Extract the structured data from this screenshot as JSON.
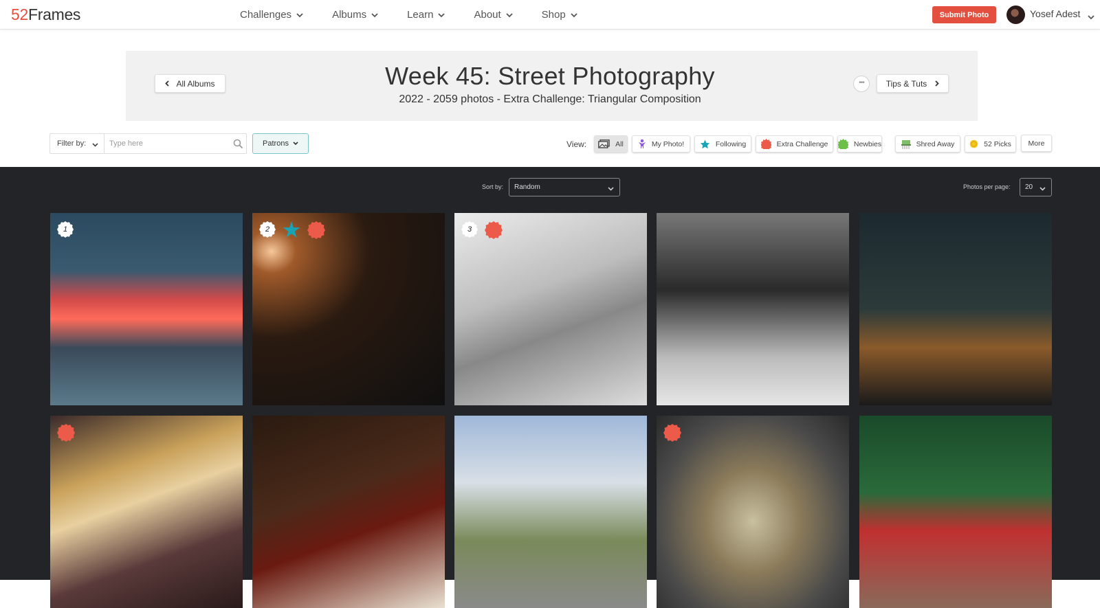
{
  "nav": {
    "logo_num": "52",
    "logo_text": "Frames",
    "menu": [
      {
        "label": "Challenges"
      },
      {
        "label": "Albums"
      },
      {
        "label": "Learn"
      },
      {
        "label": "About"
      },
      {
        "label": "Shop"
      }
    ],
    "submit_label": "Submit Photo",
    "username": "Yosef Adest"
  },
  "header": {
    "all_albums_label": "All Albums",
    "title": "Week 45: Street Photography",
    "subtitle": "2022 - 2059 photos - Extra Challenge: Triangular Composition",
    "more_label": "•••",
    "tips_label": "Tips & Tuts"
  },
  "filter": {
    "label": "Filter by:",
    "placeholder": "Type here",
    "patrons_label": "Patrons"
  },
  "view": {
    "label": "View:",
    "buttons": [
      {
        "label": "All",
        "icon": "photos-icon"
      },
      {
        "label": "My Photo!",
        "icon": "person-icon"
      },
      {
        "label": "Following",
        "icon": "star-icon"
      },
      {
        "label": "Extra Challenge",
        "icon": "burst-icon"
      },
      {
        "label": "Newbies",
        "icon": "sprout-icon"
      },
      {
        "label": "Shred Away",
        "icon": "shred-icon"
      },
      {
        "label": "52 Picks",
        "icon": "coin-icon"
      },
      {
        "label": "More",
        "icon": ""
      }
    ]
  },
  "sort": {
    "label": "Sort by:",
    "value": "Random"
  },
  "per_page": {
    "label": "Photos per page:",
    "value": "20"
  },
  "colors": {
    "brand_red": "#e4503f",
    "dark_bg": "#232428",
    "teal": "#1aa3b5"
  },
  "photos": [
    {
      "rank": "1"
    },
    {
      "rank": "2"
    },
    {
      "rank": "3"
    },
    {
      "rank": ""
    },
    {
      "rank": ""
    },
    {
      "rank": ""
    },
    {
      "rank": ""
    },
    {
      "rank": ""
    },
    {
      "rank": ""
    },
    {
      "rank": ""
    }
  ]
}
